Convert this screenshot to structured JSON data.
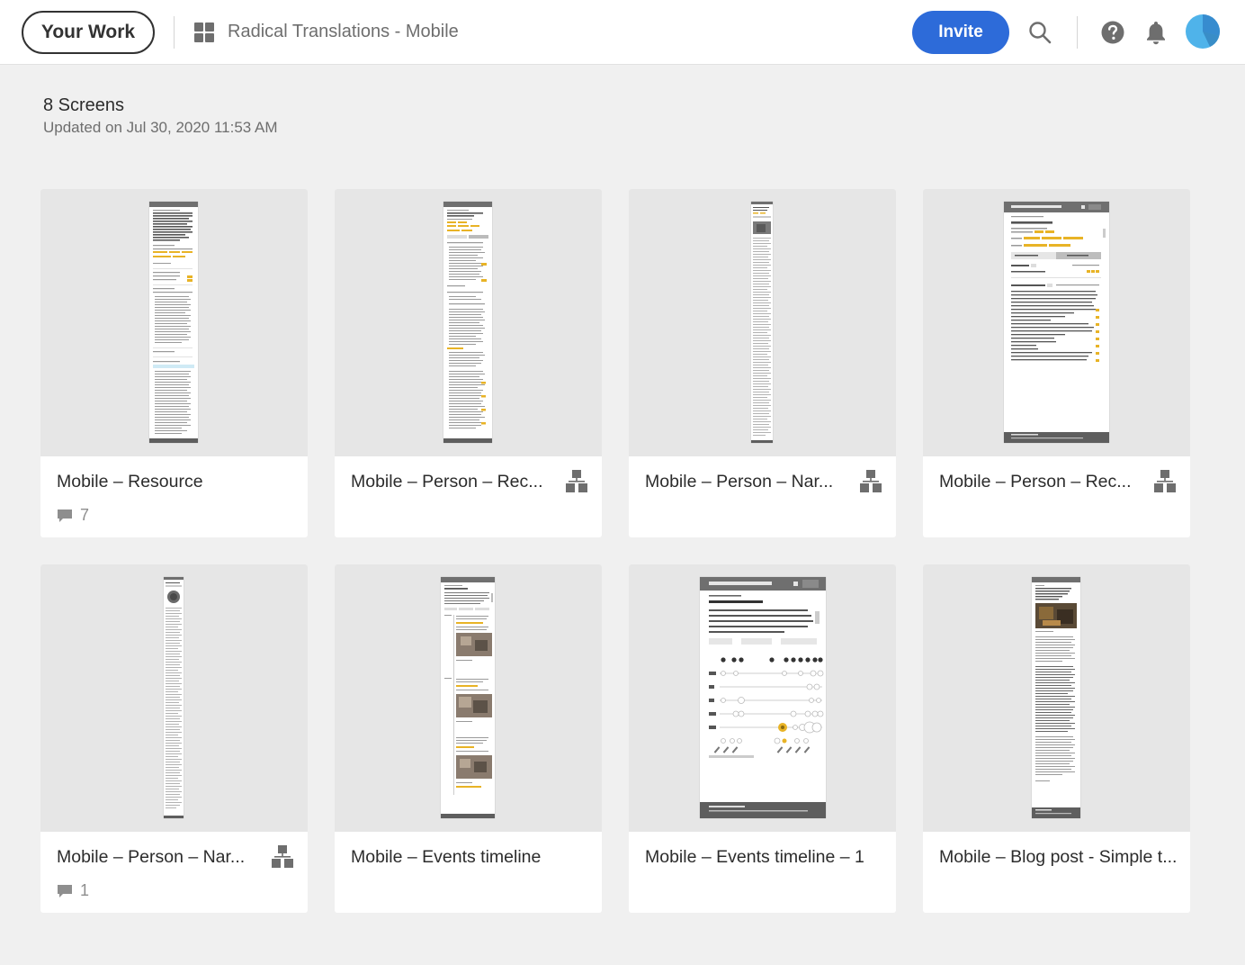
{
  "header": {
    "your_work_label": "Your Work",
    "project_title": "Radical Translations - Mobile",
    "invite_label": "Invite",
    "icons": [
      "grid-icon",
      "search-icon",
      "help-icon",
      "bell-icon",
      "avatar"
    ],
    "accent_color": "#2d6bd9"
  },
  "summary": {
    "screens_count": "8 Screens",
    "updated": "Updated on Jul 30, 2020 11:53 AM"
  },
  "cards": [
    {
      "title": "Mobile – Resource",
      "comments": "7",
      "has_flow": false
    },
    {
      "title": "Mobile – Person – Rec...",
      "comments": "",
      "has_flow": true
    },
    {
      "title": "Mobile – Person – Nar...",
      "comments": "",
      "has_flow": true
    },
    {
      "title": "Mobile – Person – Rec...",
      "comments": "",
      "has_flow": true
    },
    {
      "title": "Mobile – Person – Nar...",
      "comments": "1",
      "has_flow": true
    },
    {
      "title": "Mobile – Events timeline",
      "comments": "",
      "has_flow": false
    },
    {
      "title": "Mobile – Events timeline – 1",
      "comments": "",
      "has_flow": false
    },
    {
      "title": "Mobile – Blog post - Simple t...",
      "comments": "",
      "has_flow": false
    }
  ]
}
